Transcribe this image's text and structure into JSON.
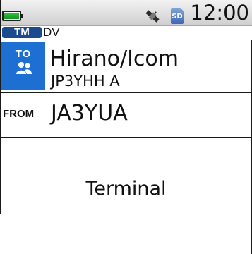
{
  "status_bar": {
    "battery_level": 1.0,
    "battery_color": "#1faa2e",
    "gps_icon": "satellite-icon",
    "sd_label": "SD",
    "clock": "12:00"
  },
  "mode": {
    "badge": "TM",
    "badge_color": "#1b4a8e",
    "label": "DV"
  },
  "to": {
    "label": "TO",
    "icon": "group-icon",
    "accent": "#1e6fd2",
    "name": "Hirano/Icom",
    "callsign": "JP3YHH A"
  },
  "from": {
    "label": "FROM",
    "callsign": "JA3YUA"
  },
  "footer": {
    "text": "Terminal"
  }
}
